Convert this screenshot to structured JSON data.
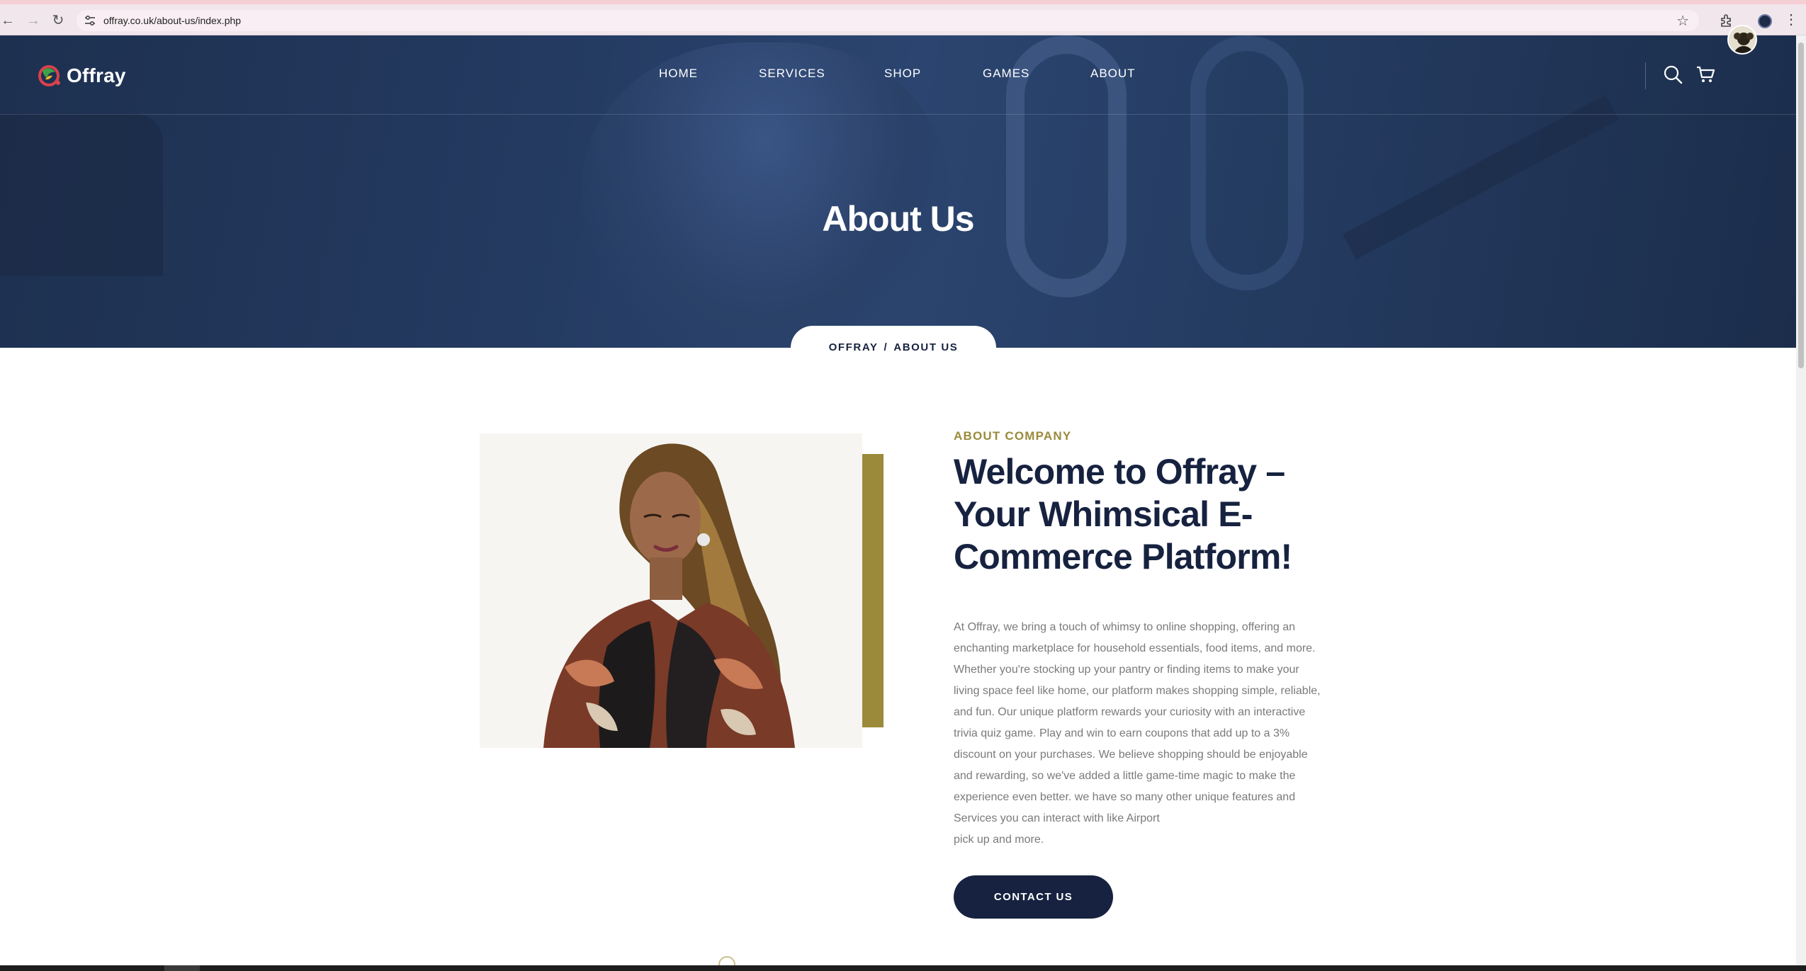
{
  "browser": {
    "url": "offray.co.uk/about-us/index.php",
    "icons": [
      "back-arrow-icon",
      "forward-arrow-icon",
      "reload-icon",
      "site-info-icon",
      "bookmark-star-icon",
      "extensions-icon",
      "profile-icon",
      "kebab-menu-icon"
    ]
  },
  "site": {
    "brand": "Offray",
    "nav": [
      "HOME",
      "SERVICES",
      "SHOP",
      "GAMES",
      "ABOUT"
    ],
    "icons": [
      "search-icon",
      "cart-icon",
      "user-avatar"
    ]
  },
  "hero": {
    "title": "About Us",
    "breadcrumb": {
      "home": "OFFRAY",
      "separator": "/",
      "current": "ABOUT US"
    }
  },
  "about": {
    "eyebrow": "ABOUT COMPANY",
    "heading": "Welcome to Offray – Your Whimsical E-Commerce Platform!",
    "body": "At Offray, we bring a touch of whimsy to online shopping, offering an enchanting marketplace for household essentials, food items, and more. Whether you're stocking up your pantry or finding items to make your living space feel like home, our platform makes shopping simple, reliable, and fun. Our unique platform rewards your curiosity with an interactive trivia quiz game. Play and win to earn coupons that add up to a 3% discount on your purchases. We believe shopping should be enjoyable and rewarding, so we've added a little game-time magic to make the experience even better. we have so many other unique features and Services you can interact with like Airport",
    "body_tail": "pick up and more.",
    "cta": "CONTACT US"
  },
  "colors": {
    "navy": "#16223f",
    "gold": "#9a8a3a",
    "hero_overlay": "#243a60",
    "body_text": "#7a7a7a"
  }
}
